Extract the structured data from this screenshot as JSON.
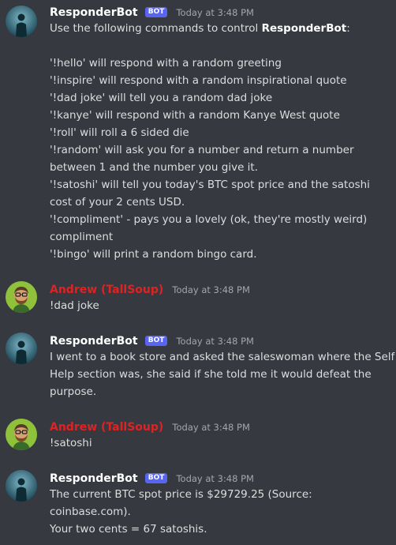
{
  "bot_badge": "BOT",
  "colors": {
    "background": "#36393f",
    "bot_name": "#ffffff",
    "user_name": "#e02222",
    "badge": "#5865f2"
  },
  "messages": [
    {
      "author": "ResponderBot",
      "timestamp": "Today at 3:48 PM",
      "intro_before": "Use the following commands to control ",
      "intro_bold": "ResponderBot",
      "intro_after": ":",
      "lines": [
        "'!hello' will respond with a random greeting",
        "'!inspire' will respond with a random inspirational quote",
        "'!dad joke' will tell you a random dad joke",
        "'!kanye' will respond with a random Kanye West quote",
        "'!roll' will roll a 6 sided die",
        "'!random' will ask you for a number and return a number",
        "between 1 and the number you give it.",
        "'!satoshi' will tell you today's BTC spot price and the satoshi",
        "cost of your 2 cents USD.",
        "'!compliment' - pays you a lovely (ok, they're mostly weird)",
        "compliment",
        "'!bingo' will print a random bingo card."
      ]
    },
    {
      "author": "Andrew (TallSoup)",
      "timestamp": "Today at 3:48 PM",
      "lines": [
        "!dad joke"
      ]
    },
    {
      "author": "ResponderBot",
      "timestamp": "Today at 3:48 PM",
      "lines": [
        "I went to a book store and asked the saleswoman where the Self",
        "Help section was, she said if she told me it would defeat the",
        "purpose."
      ]
    },
    {
      "author": "Andrew (TallSoup)",
      "timestamp": "Today at 3:48 PM",
      "lines": [
        "!satoshi"
      ]
    },
    {
      "author": "ResponderBot",
      "timestamp": "Today at 3:48 PM",
      "lines": [
        "The current BTC spot price is $29729.25 (Source:",
        "coinbase.com).",
        "Your two cents = 67 satoshis."
      ]
    }
  ]
}
